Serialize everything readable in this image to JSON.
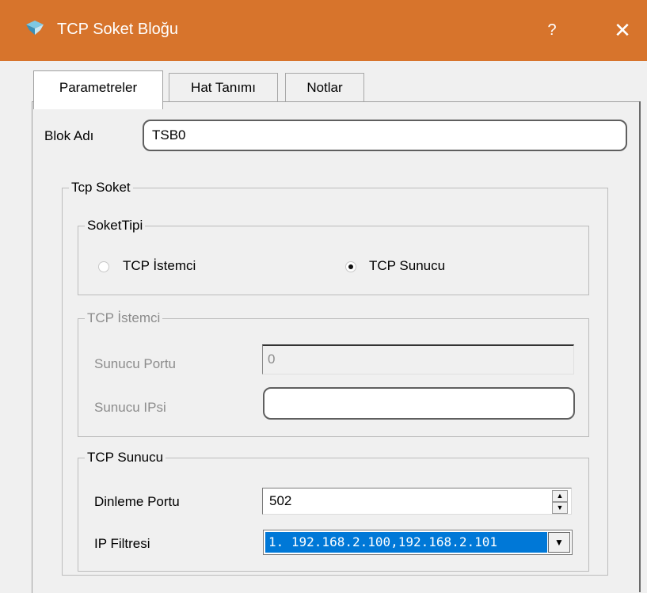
{
  "window": {
    "title": "TCP Soket Bloğu",
    "help": "?",
    "close": "✕"
  },
  "tabs": [
    {
      "label": "Parametreler",
      "active": true
    },
    {
      "label": "Hat Tanımı",
      "active": false
    },
    {
      "label": "Notlar",
      "active": false
    }
  ],
  "block_name": {
    "label": "Blok Adı",
    "value": "TSB0"
  },
  "tcp_socket": {
    "group_label": "Tcp Soket",
    "socket_type": {
      "group_label": "SoketTipi",
      "options": [
        {
          "label": "TCP İstemci",
          "checked": false
        },
        {
          "label": "TCP Sunucu",
          "checked": true
        }
      ]
    },
    "client": {
      "group_label": "TCP İstemci",
      "server_port_label": "Sunucu Portu",
      "server_port_value": "0",
      "server_ip_label": "Sunucu IPsi",
      "server_ip_value": ""
    },
    "server": {
      "group_label": "TCP Sunucu",
      "listen_port_label": "Dinleme Portu",
      "listen_port_value": "502",
      "ip_filter_label": "IP Filtresi",
      "ip_filter_value": "1. 192.168.2.100,192.168.2.101"
    }
  },
  "colors": {
    "titlebar": "#d7742c",
    "selection": "#0078d7"
  }
}
